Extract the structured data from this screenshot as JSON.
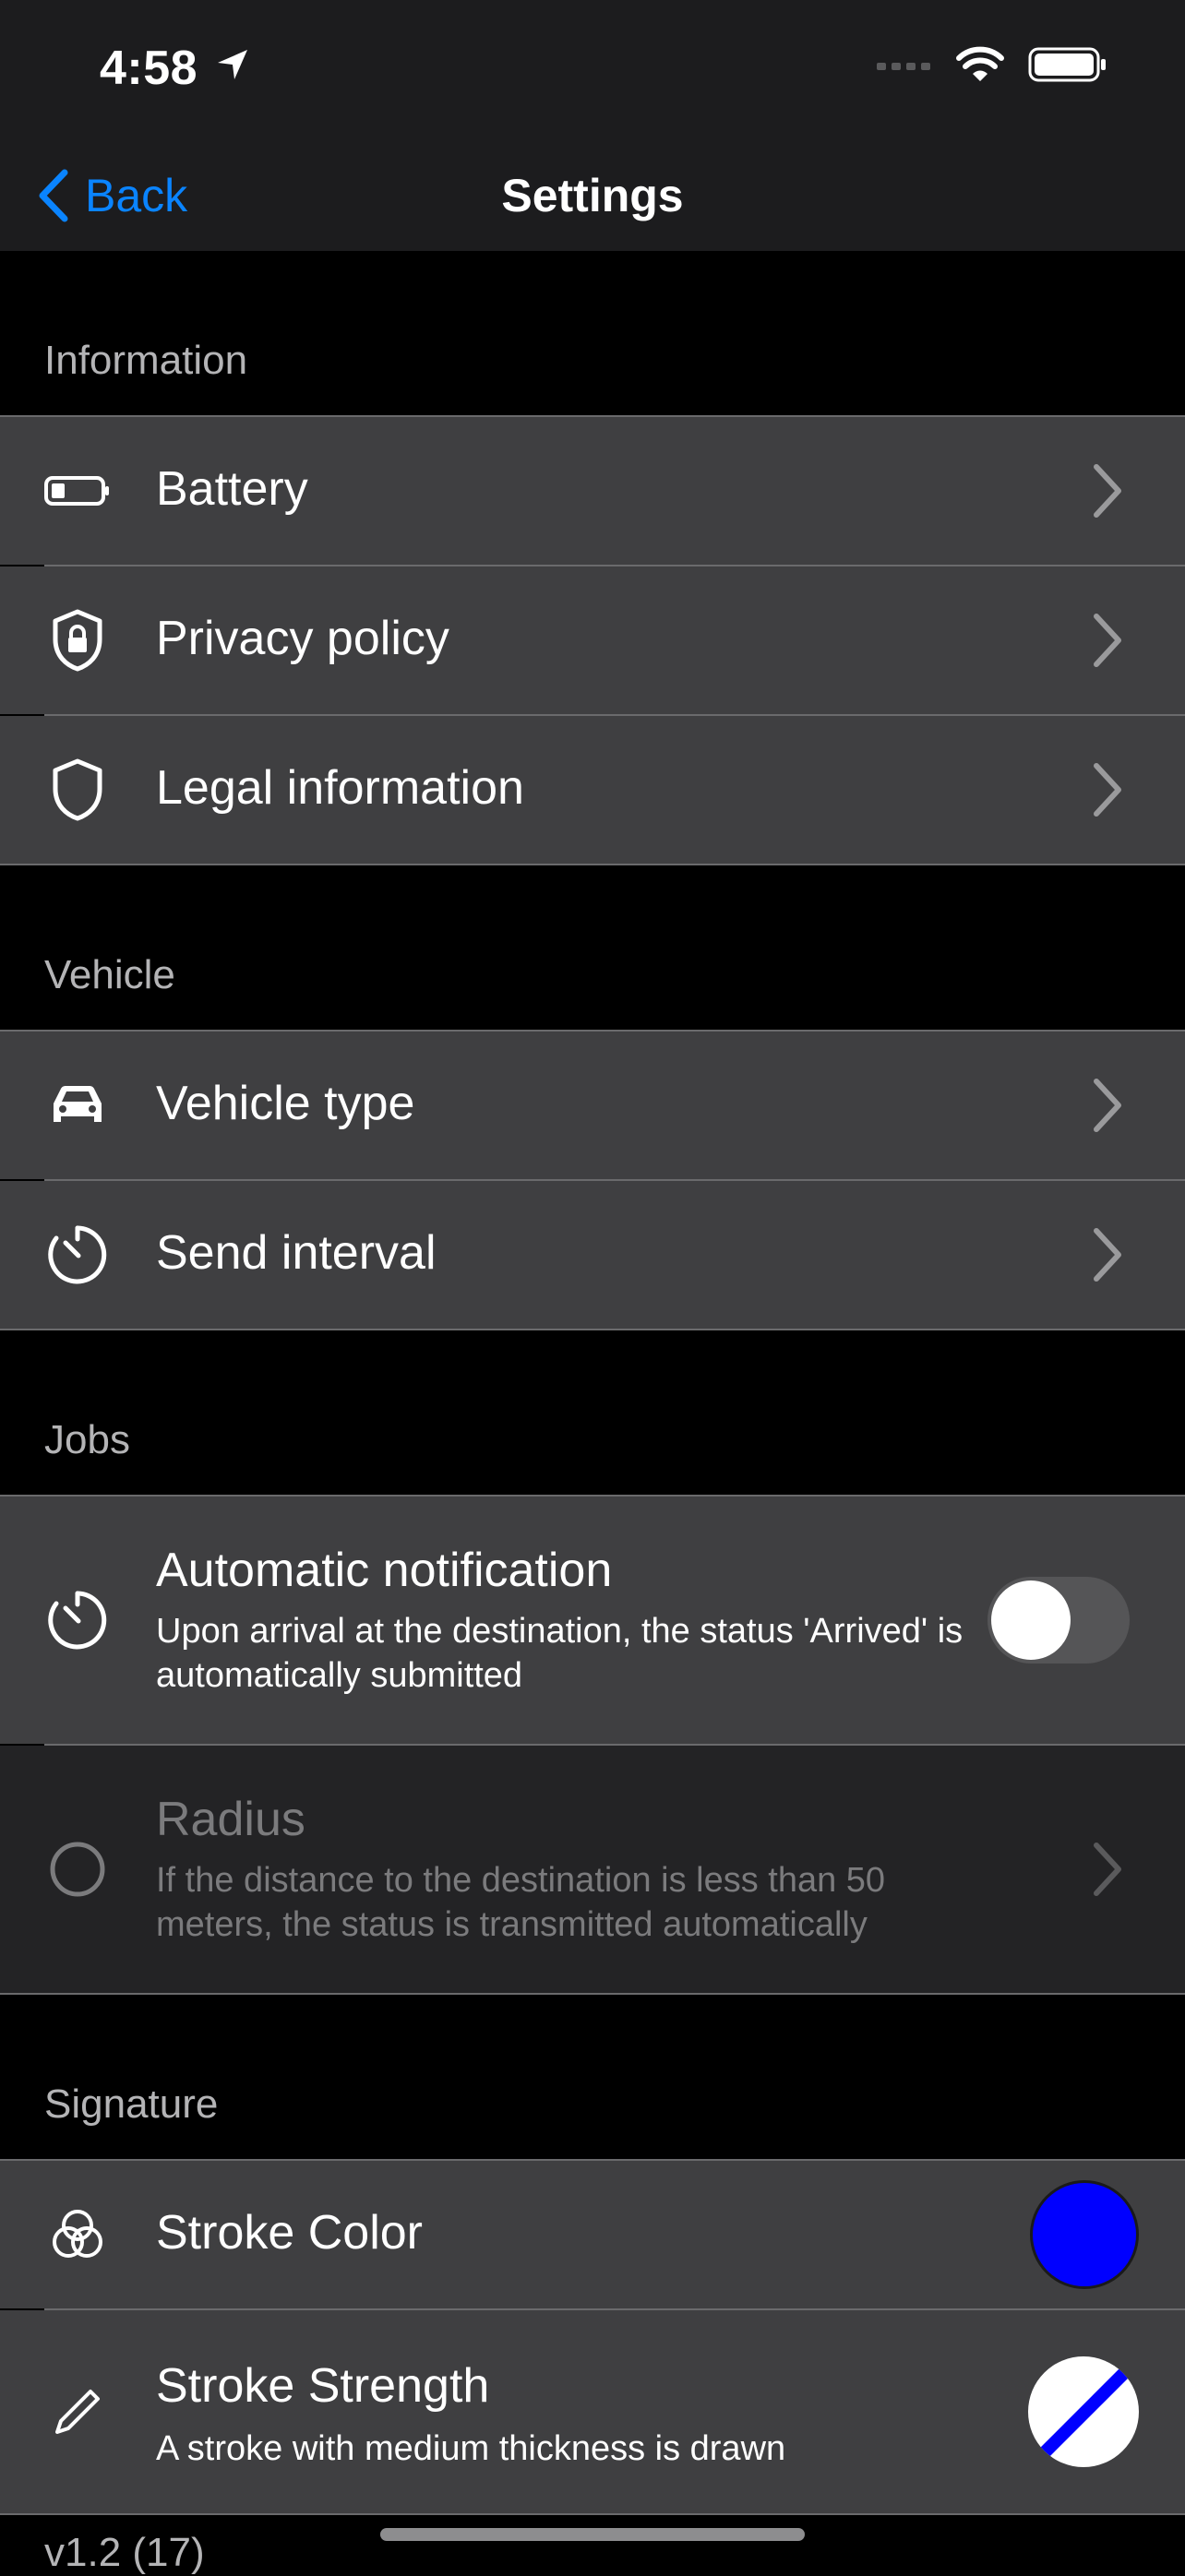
{
  "status_bar": {
    "time": "4:58"
  },
  "nav": {
    "back_label": "Back",
    "title": "Settings"
  },
  "sections": {
    "information": {
      "header": "Information",
      "items": [
        {
          "label": "Battery",
          "icon": "battery-icon"
        },
        {
          "label": "Privacy policy",
          "icon": "lock-shield-icon"
        },
        {
          "label": "Legal information",
          "icon": "shield-icon"
        }
      ]
    },
    "vehicle": {
      "header": "Vehicle",
      "items": [
        {
          "label": "Vehicle type",
          "icon": "car-icon"
        },
        {
          "label": "Send interval",
          "icon": "timer-icon"
        }
      ]
    },
    "jobs": {
      "header": "Jobs",
      "automatic_notification": {
        "label": "Automatic notification",
        "subtitle": "Upon arrival at the destination, the status 'Arrived' is automatically submitted",
        "enabled": false
      },
      "radius": {
        "label": "Radius",
        "subtitle": "If the distance to the destination is less than 50 meters, the status is transmitted automatically",
        "disabled": true
      }
    },
    "signature": {
      "header": "Signature",
      "stroke_color": {
        "label": "Stroke Color",
        "color": "#0000ff"
      },
      "stroke_strength": {
        "label": "Stroke Strength",
        "subtitle": "A stroke with medium thickness is drawn"
      }
    }
  },
  "footer": {
    "version": "v1.2 (17)"
  },
  "colors": {
    "accent": "#0a84ff",
    "row_bg": "#3f3f41",
    "row_disabled_bg": "#232325",
    "nav_bg": "#1c1c1e"
  }
}
